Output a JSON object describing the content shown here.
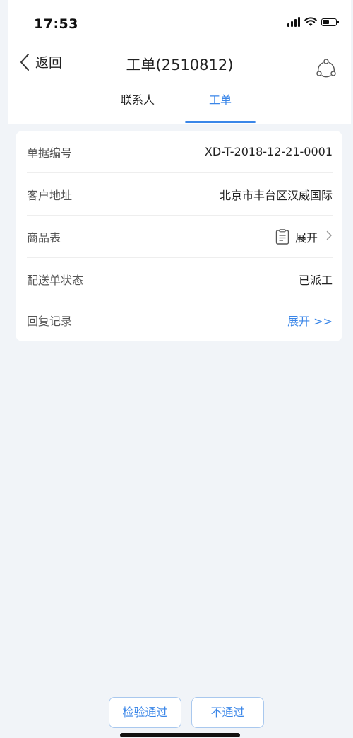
{
  "status_bar": {
    "time": "17:53"
  },
  "nav": {
    "back_label": "返回",
    "title": "工单(2510812)"
  },
  "tabs": [
    {
      "label": "联系人",
      "active": false
    },
    {
      "label": "工单",
      "active": true
    }
  ],
  "details": {
    "rows": [
      {
        "label": "单据编号",
        "value": "XD-T-2018-12-21-0001"
      },
      {
        "label": "客户地址",
        "value": "北京市丰台区汉威国际"
      },
      {
        "label": "商品表",
        "value": "展开",
        "icon": "document-icon",
        "suffix_icon": "chevron-right-icon"
      },
      {
        "label": "配送单状态",
        "value": "已派工"
      },
      {
        "label": "回复记录",
        "value": "展开 >>"
      }
    ]
  },
  "actions": {
    "pass_label": "检验通过",
    "fail_label": "不通过"
  },
  "colors": {
    "accent": "#3a86e8",
    "background": "#f1f4f8",
    "card": "#ffffff"
  }
}
